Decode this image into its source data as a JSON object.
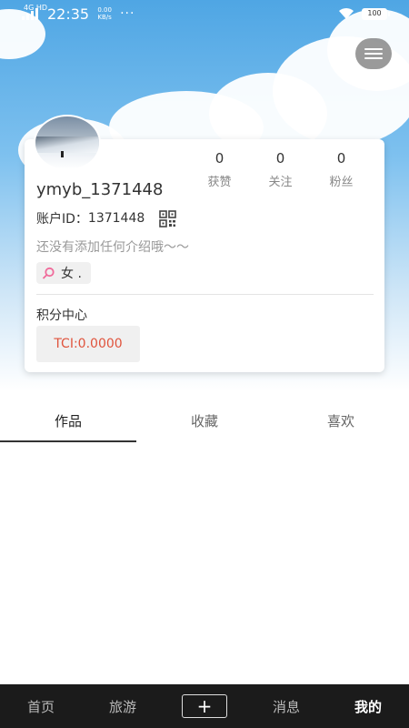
{
  "status_bar": {
    "network_type": "4G HD",
    "time": "22:35",
    "speed_value": "0.00",
    "speed_unit": "KB/s",
    "more": "···",
    "battery": "100"
  },
  "profile": {
    "username": "ymyb_1371448",
    "account_label": "账户ID：",
    "account_id": "1371448",
    "intro": "还没有添加任何介绍哦～～",
    "gender": "女 ."
  },
  "stats": [
    {
      "value": "0",
      "label": "获赞"
    },
    {
      "value": "0",
      "label": "关注"
    },
    {
      "value": "0",
      "label": "粉丝"
    }
  ],
  "points": {
    "title": "积分中心",
    "value": "TCI:0.0000"
  },
  "tabs": [
    {
      "label": "作品",
      "active": true
    },
    {
      "label": "收藏",
      "active": false
    },
    {
      "label": "喜欢",
      "active": false
    }
  ],
  "bottom_nav": [
    {
      "label": "首页"
    },
    {
      "label": "旅游"
    },
    {
      "label": "+"
    },
    {
      "label": "消息"
    },
    {
      "label": "我的"
    }
  ],
  "icons": {
    "menu": "menu-icon",
    "qr": "qr-code-icon",
    "gender": "female-icon",
    "wifi": "wifi-icon"
  },
  "colors": {
    "accent_points": "#e0533c",
    "gender_icon": "#f06a9a",
    "nav_bg": "#1b1b1b"
  }
}
